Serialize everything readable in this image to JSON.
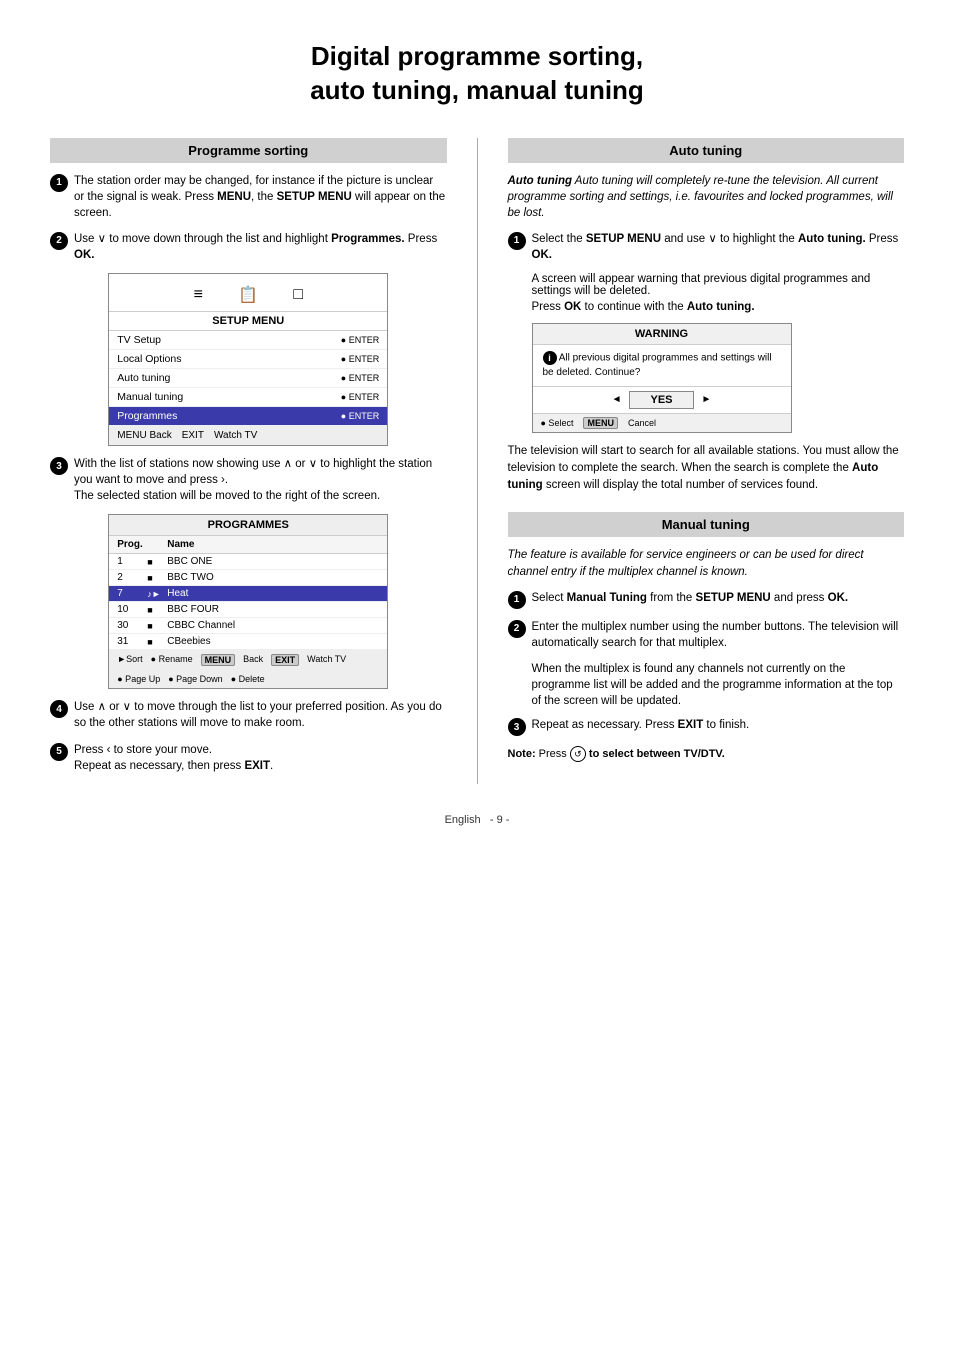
{
  "page": {
    "title_line1": "Digital  programme  sorting,",
    "title_line2": "auto  tuning,  manual  tuning"
  },
  "programme_sorting": {
    "header": "Programme sorting",
    "step1": {
      "text": "The station order may be changed, for instance if the picture is unclear or the signal is weak.  Press ",
      "bold1": "MENU",
      "text2": ", the ",
      "bold2": "SETUP MENU",
      "text3": " will appear on the screen."
    },
    "step2": {
      "text_before": "Use ",
      "chevron_down": "∨",
      "text_after": " to move down through the list  and highlight ",
      "bold1": "Programmes.",
      "text2": " Press ",
      "bold2": "OK."
    },
    "setup_menu": {
      "title": "SETUP MENU",
      "icons": [
        "≡≡",
        "📋",
        "□"
      ],
      "rows": [
        {
          "label": "TV Setup",
          "enter": "● ENTER",
          "highlighted": false
        },
        {
          "label": "Local Options",
          "enter": "● ENTER",
          "highlighted": false
        },
        {
          "label": "Auto tuning",
          "enter": "● ENTER",
          "highlighted": false
        },
        {
          "label": "Manual tuning",
          "enter": "● ENTER",
          "highlighted": false
        },
        {
          "label": "Programmes",
          "enter": "● ENTER",
          "highlighted": true
        }
      ],
      "footer": [
        "MENU Back",
        "EXIT",
        "Watch TV"
      ]
    },
    "step3": {
      "text1": "With the list of stations now showing use ",
      "up_arrow": "∧",
      "text2": " or ",
      "down_arrow": "∨",
      "text3": " to highlight the station you want to move and press ",
      "chevron_right": "›",
      "text4": ". The selected station will be moved to the right of the screen."
    },
    "programmes_table": {
      "title": "PROGRAMMES",
      "col1": "Prog.",
      "col2": "Name",
      "rows": [
        {
          "num": "1",
          "icon": "■",
          "name": "BBC ONE"
        },
        {
          "num": "2",
          "icon": "■",
          "name": "BBC TWO"
        },
        {
          "num": "7",
          "icon": "♪►",
          "name": "Heat",
          "highlighted": true
        },
        {
          "num": "10",
          "icon": "■",
          "name": "BBC FOUR"
        },
        {
          "num": "30",
          "icon": "■",
          "name": "CBBC Channel"
        },
        {
          "num": "31",
          "icon": "■",
          "name": "CBeebies"
        }
      ],
      "footer_items": [
        "►Sort",
        "● Rename",
        "MENU Back",
        "EXIT Watch TV",
        "● Page Up",
        "● Page Down",
        "● Delete"
      ]
    },
    "step4": {
      "text1": "Use ",
      "up": "∧",
      "text2": " or ",
      "down": "∨",
      "text3": " to move through the list to your preferred position. As you do so the other stations will move to make room."
    },
    "step5": {
      "text1": "Press ",
      "chevron_left": "‹",
      "text2": " to store your move.",
      "repeat": "Repeat as necessary, then press ",
      "bold_exit": "EXIT",
      "period": "."
    }
  },
  "auto_tuning": {
    "header": "Auto tuning",
    "intro": "Auto tuning will completely re-tune the television. All current programme sorting and settings, i.e. favourites and locked programmes, will be lost.",
    "step1": {
      "text1": "Select the ",
      "bold1": "SETUP MENU",
      "text2": " and use ",
      "chevron": "∨",
      "text3": " to highlight the ",
      "bold2": "Auto tuning.",
      "text4": " Press ",
      "bold3": "OK."
    },
    "step1b": "A screen will appear warning that previous digital programmes and settings will be deleted.",
    "step1c": "Press ",
    "bold_ok": "OK",
    "step1c2": " to continue with the ",
    "bold_auto": "Auto tuning.",
    "warning_box": {
      "title": "WARNING",
      "content_icon": "i",
      "content": "All previous digital programmes and settings will be deleted. Continue?",
      "yes_label": "YES",
      "footer_select": "● Select",
      "footer_menu": "MENU",
      "footer_cancel": "Cancel"
    },
    "step2": "The television will start to search for all available stations. You must allow the television to complete the search. When the search is complete the ",
    "bold_auto2": "Auto tuning",
    "step2b": " screen will display the total number of services found."
  },
  "manual_tuning": {
    "header": "Manual tuning",
    "intro": "The feature is available for service engineers or  can be used for direct channel entry if the multiplex channel is known.",
    "step1": {
      "text1": "Select ",
      "bold1": "Manual Tuning",
      "text2": " from the ",
      "bold2": "SETUP MENU",
      "text3": " and press ",
      "bold3": "OK."
    },
    "step2": {
      "text1": "Enter the multiplex number using the number buttons. The television will automatically search for that multiplex."
    },
    "step2b": "When the multiplex is found any channels not currently on the programme list will be added and the programme information at the top of the screen will be updated.",
    "step3": {
      "text1": "Repeat as necessary. Press ",
      "bold1": "EXIT",
      "text2": " to finish."
    },
    "note": "Note: Press ",
    "note_icon": "↺",
    "note2": " to select between TV/DTV."
  },
  "footer": {
    "language": "English",
    "page_num": "- 9 -"
  }
}
